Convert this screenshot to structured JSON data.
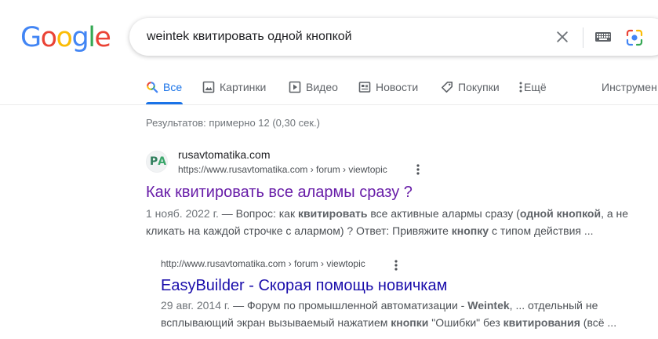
{
  "logo": {
    "letters": [
      {
        "ch": "G",
        "color": "#4285F4"
      },
      {
        "ch": "o",
        "color": "#EA4335"
      },
      {
        "ch": "o",
        "color": "#FBBC05"
      },
      {
        "ch": "g",
        "color": "#4285F4"
      },
      {
        "ch": "l",
        "color": "#34A853"
      },
      {
        "ch": "e",
        "color": "#EA4335"
      }
    ]
  },
  "search": {
    "query": "weintek квитировать одной кнопкой",
    "icons": [
      "close-icon",
      "keyboard-icon",
      "google-lens-icon"
    ]
  },
  "tabs": [
    {
      "label": "Все",
      "icon": "search-icon",
      "active": true
    },
    {
      "label": "Картинки",
      "icon": "image-icon",
      "active": false
    },
    {
      "label": "Видео",
      "icon": "play-icon",
      "active": false
    },
    {
      "label": "Новости",
      "icon": "news-icon",
      "active": false
    },
    {
      "label": "Покупки",
      "icon": "tag-icon",
      "active": false
    },
    {
      "label": "Ещё",
      "icon": "more-vert-icon",
      "active": false
    }
  ],
  "tools_label": "Инструмен",
  "stats": "Результатов: примерно 12 (0,30 сек.)",
  "colors": {
    "accent": "#1a73e8",
    "visited_link": "#681da8",
    "link": "#1a0dab"
  },
  "results": [
    {
      "site_name": "rusavtomatika.com",
      "url": "https://www.rusavtomatika.com › forum › viewtopic",
      "title": "Как квитировать все алармы сразу ?",
      "date": "1 нояб. 2022 г.",
      "snippet_parts": [
        {
          "t": " — Вопрос: как ",
          "b": false
        },
        {
          "t": "квитировать",
          "b": true
        },
        {
          "t": " все активные алармы сразу (",
          "b": false
        },
        {
          "t": "одной кнопкой",
          "b": true
        },
        {
          "t": ", а не кликать на каждой строчке с алармом) ? Ответ: Привяжите ",
          "b": false
        },
        {
          "t": "кнопку",
          "b": true
        },
        {
          "t": " с типом действия ...",
          "b": false
        }
      ]
    },
    {
      "url": "http://www.rusavtomatika.com › forum › viewtopic",
      "title": "EasyBuilder - Скорая помощь новичкам",
      "date": "29 авг. 2014 г.",
      "snippet_parts": [
        {
          "t": " — Форум по промышленной автоматизации - ",
          "b": false
        },
        {
          "t": "Weintek",
          "b": true
        },
        {
          "t": ", ... отдельный не всплывающий экран вызываемый нажатием ",
          "b": false
        },
        {
          "t": "кнопки",
          "b": true
        },
        {
          "t": " \"Ошибки\" без ",
          "b": false
        },
        {
          "t": "квитирования",
          "b": true
        },
        {
          "t": " (всё ...",
          "b": false
        }
      ]
    }
  ]
}
